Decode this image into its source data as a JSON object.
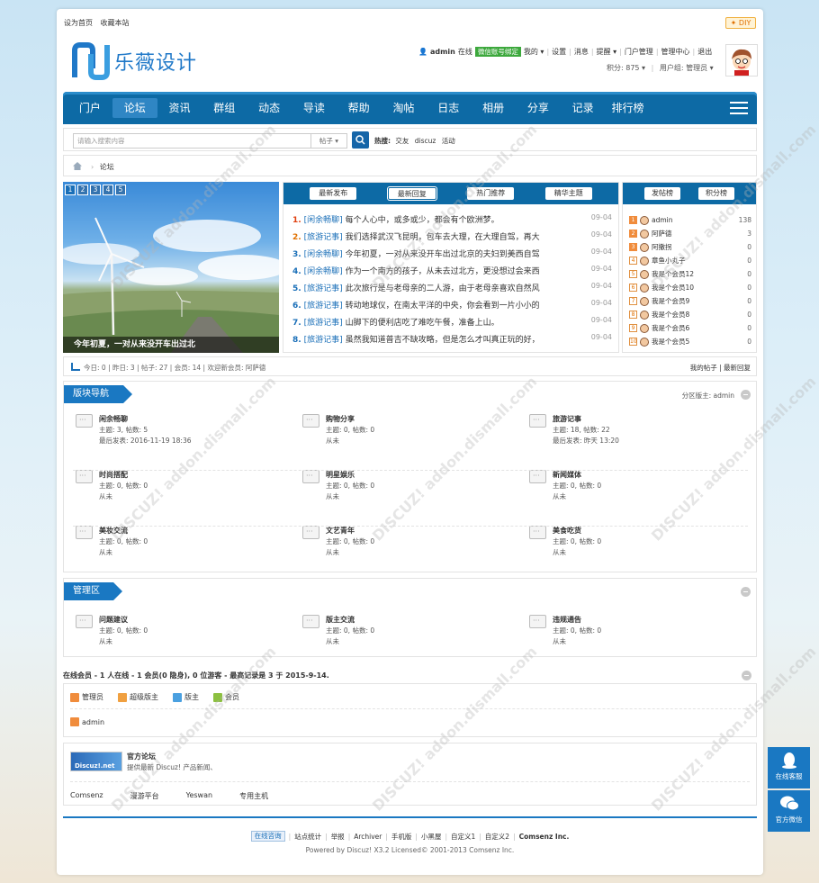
{
  "topbar": {
    "set_home": "设为首页",
    "favorite": "收藏本站",
    "diy": "✦ DIY"
  },
  "logo": {
    "title": "乐薇设计"
  },
  "user": {
    "name": "admin",
    "status": "在线",
    "wechat": "微信账号绑定",
    "links": [
      "我的 ▾",
      "设置",
      "消息",
      "提醒 ▾",
      "门户管理",
      "管理中心",
      "退出"
    ],
    "credits": "积分: 875 ▾",
    "usergroup": "用户组: 管理员 ▾"
  },
  "nav": {
    "items": [
      "门户",
      "论坛",
      "资讯",
      "群组",
      "动态",
      "导读",
      "帮助",
      "淘帖",
      "日志",
      "相册",
      "分享",
      "记录",
      "排行榜"
    ],
    "active": "论坛"
  },
  "search": {
    "placeholder": "请输入搜索内容",
    "type": "帖子 ▾",
    "hot_label": "热搜:",
    "hot": [
      "交友",
      "discuz",
      "活动"
    ]
  },
  "breadcrumb": {
    "current": "论坛"
  },
  "slider": {
    "dots": [
      "1",
      "2",
      "3",
      "4",
      "5"
    ],
    "caption": "今年初夏，一对从来没开车出过北"
  },
  "thread_tabs": [
    "最新发布",
    "最新回复",
    "热门推荐",
    "精华主题"
  ],
  "threads": [
    {
      "n": "1.",
      "cat": "[闲余畅聊]",
      "title": "每个人心中，或多或少，都会有个欧洲梦。",
      "date": "09-04"
    },
    {
      "n": "2.",
      "cat": "[旅游记事]",
      "title": "我们选择武汉飞昆明，包车去大理，在大理自驾，再大",
      "date": "09-04"
    },
    {
      "n": "3.",
      "cat": "[闲余畅聊]",
      "title": "今年初夏，一对从来没开车出过北京的夫妇到美西自驾",
      "date": "09-04"
    },
    {
      "n": "4.",
      "cat": "[闲余畅聊]",
      "title": "作为一个南方的孩子，从未去过北方，更没想过会来西",
      "date": "09-04"
    },
    {
      "n": "5.",
      "cat": "[旅游记事]",
      "title": "此次旅行是与老母亲的二人游，由于老母亲喜欢自然风",
      "date": "09-04"
    },
    {
      "n": "6.",
      "cat": "[旅游记事]",
      "title": "转动地球仪，在南太平洋的中央，你会看到一片小小的",
      "date": "09-04"
    },
    {
      "n": "7.",
      "cat": "[旅游记事]",
      "title": "山脚下的便利店吃了难吃午餐，准备上山。",
      "date": "09-04"
    },
    {
      "n": "8.",
      "cat": "[旅游记事]",
      "title": "虽然我知道普吉不缺攻略，但是怎么才叫真正玩的好，",
      "date": "09-04"
    }
  ],
  "rank_tabs": [
    "发帖榜",
    "积分榜"
  ],
  "rank": [
    {
      "no": "1",
      "name": "admin",
      "v": "138"
    },
    {
      "no": "2",
      "name": "阿萨德",
      "v": "3"
    },
    {
      "no": "3",
      "name": "阿撒拐",
      "v": "0"
    },
    {
      "no": "4",
      "name": "章鱼小丸子",
      "v": "0"
    },
    {
      "no": "5",
      "name": "我是个会员12",
      "v": "0"
    },
    {
      "no": "6",
      "name": "我是个会员10",
      "v": "0"
    },
    {
      "no": "7",
      "name": "我是个会员9",
      "v": "0"
    },
    {
      "no": "8",
      "name": "我是个会员8",
      "v": "0"
    },
    {
      "no": "9",
      "name": "我是个会员6",
      "v": "0"
    },
    {
      "no": "10",
      "name": "我是个会员5",
      "v": "0"
    }
  ],
  "stats": {
    "text": "今日: 0 | 昨日: 3 | 帖子: 27 | 会员: 14 | 欢迎新会员: 阿萨德",
    "right": "我的帖子 | 最新回复"
  },
  "section1": {
    "title": "版块导航",
    "moderator": "分区版主: admin",
    "forums": [
      {
        "name": "闲余畅聊",
        "l2": "主题: 3, 帖数: 5",
        "l3": "最后发表: 2016-11-19 18:36"
      },
      {
        "name": "购物分享",
        "l2": "主题: 0, 帖数: 0",
        "l3": "从未"
      },
      {
        "name": "旅游记事",
        "l2": "主题: 18, 帖数: 22",
        "l3": "最后发表: 昨天 13:20"
      },
      {
        "name": "时尚搭配",
        "l2": "主题: 0, 帖数: 0",
        "l3": "从未"
      },
      {
        "name": "明星娱乐",
        "l2": "主题: 0, 帖数: 0",
        "l3": "从未"
      },
      {
        "name": "新闻媒体",
        "l2": "主题: 0, 帖数: 0",
        "l3": "从未"
      },
      {
        "name": "美妆交流",
        "l2": "主题: 0, 帖数: 0",
        "l3": "从未"
      },
      {
        "name": "文艺青年",
        "l2": "主题: 0, 帖数: 0",
        "l3": "从未"
      },
      {
        "name": "美食吃货",
        "l2": "主题: 0, 帖数: 0",
        "l3": "从未"
      }
    ]
  },
  "section2": {
    "title": "管理区",
    "forums": [
      {
        "name": "问题建议",
        "l2": "主题: 0, 帖数: 0",
        "l3": "从未"
      },
      {
        "name": "版主交流",
        "l2": "主题: 0, 帖数: 0",
        "l3": "从未"
      },
      {
        "name": "违规通告",
        "l2": "主题: 0, 帖数: 0",
        "l3": "从未"
      }
    ]
  },
  "online": {
    "head": "在线会员 - 1 人在线 - 1 会员(0 隐身), 0 位游客 - 最高记录是 3 于 2015-9-14.",
    "legend": [
      "管理员",
      "超级版主",
      "版主",
      "会员"
    ],
    "legend_colors": [
      "#f08c3c",
      "#f0a040",
      "#4aa0e0",
      "#8cc040"
    ],
    "users": [
      "admin"
    ]
  },
  "links": {
    "logo_text": "Discuz!.net",
    "title": "官方论坛",
    "desc": "提供最新 Discuz! 产品新闻、",
    "items": [
      "Comsenz",
      "漫游平台",
      "Yeswan",
      "专用主机"
    ]
  },
  "footer": {
    "consult": "在线咨询",
    "links": [
      "站点统计",
      "举报",
      "Archiver",
      "手机版",
      "小黑屋",
      "自定义1",
      "自定义2"
    ],
    "company": "Comsenz Inc.",
    "powered": "Powered by Discuz! X3.2 Licensed© 2001-2013 Comsenz Inc."
  },
  "side": {
    "service": "在线客服",
    "wechat": "官方微信"
  },
  "colors": {
    "primary": "#0d6aa5",
    "accent": "#1a78c2"
  }
}
